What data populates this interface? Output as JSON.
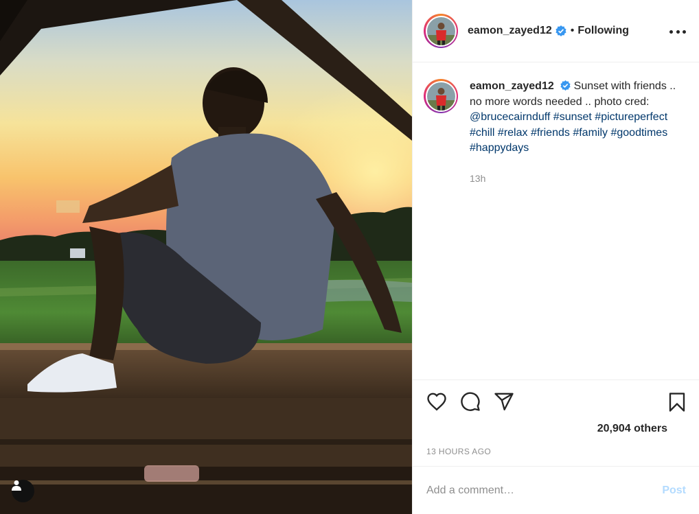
{
  "post": {
    "author": {
      "username": "eamon_zayed12",
      "verified_icon": "verified-badge-icon",
      "follow_state": "Following",
      "separator": "•"
    },
    "caption": {
      "username": "eamon_zayed12",
      "text_parts": [
        {
          "type": "text",
          "value": "Sunset with friends .. no more words needed .. photo cred: "
        },
        {
          "type": "mention",
          "value": "@brucecairnduff"
        },
        {
          "type": "text",
          "value": " "
        },
        {
          "type": "tag",
          "value": "#sunset"
        },
        {
          "type": "text",
          "value": " "
        },
        {
          "type": "tag",
          "value": "#pictureperfect"
        },
        {
          "type": "text",
          "value": " "
        },
        {
          "type": "tag",
          "value": "#chill"
        },
        {
          "type": "text",
          "value": " "
        },
        {
          "type": "tag",
          "value": "#relax"
        },
        {
          "type": "text",
          "value": " "
        },
        {
          "type": "tag",
          "value": "#friends"
        },
        {
          "type": "text",
          "value": " "
        },
        {
          "type": "tag",
          "value": "#family"
        },
        {
          "type": "text",
          "value": " "
        },
        {
          "type": "tag",
          "value": "#goodtimes"
        },
        {
          "type": "text",
          "value": " "
        },
        {
          "type": "tag",
          "value": "#happydays"
        }
      ],
      "age": "13h"
    },
    "likes_text": "20,904 others",
    "timestamp": "13 HOURS AGO",
    "comment": {
      "placeholder": "Add a comment…",
      "post_label": "Post"
    },
    "icons": {
      "like": "heart-icon",
      "comment": "comment-icon",
      "share": "paper-plane-icon",
      "save": "bookmark-icon",
      "more": "more-options-icon",
      "user_tag": "user-tag-icon"
    },
    "colors": {
      "link": "#00376b",
      "muted": "#8e8e8e",
      "post_button_disabled": "#b3dbff",
      "verified": "#3897f0"
    }
  }
}
